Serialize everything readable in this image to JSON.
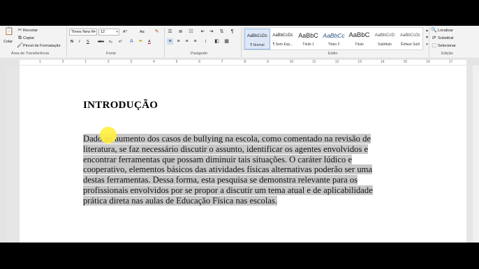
{
  "ribbon": {
    "clipboard": {
      "paste_label": "Colar",
      "cut_label": "Recortar",
      "copy_label": "Copiar",
      "format_painter_label": "Pincel de Formatação",
      "group_label": "Área de Transferência"
    },
    "font": {
      "font_name": "Times New R",
      "font_size": "12",
      "group_label": "Fonte",
      "bold": "N",
      "italic": "I",
      "underline": "S",
      "strike": "abc",
      "subscript": "x₂",
      "superscript": "x²",
      "grow": "A^",
      "case": "Aa",
      "font_color_letter": "A"
    },
    "paragraph": {
      "group_label": "Parágrafo"
    },
    "styles": {
      "group_label": "Estilo",
      "tiles": [
        {
          "preview": "AaBbCcDc",
          "name": "¶ Normal"
        },
        {
          "preview": "AaBbCcDc",
          "name": "¶ Sem Esp..."
        },
        {
          "preview": "AaBbC",
          "name": "Título 1"
        },
        {
          "preview": "AaBbCc",
          "name": "Título 2"
        },
        {
          "preview": "AaBbC",
          "name": "Título"
        },
        {
          "preview": "AaBbCcD",
          "name": "Subtítulo"
        },
        {
          "preview": "AaBbCcDc",
          "name": "Ênfase Sutil"
        }
      ]
    },
    "editing": {
      "find_label": "Localizar",
      "replace_label": "Substituir",
      "select_label": "Selecionar",
      "group_label": "Edição"
    }
  },
  "ruler": {
    "numbers": [
      "1",
      "2",
      "1",
      "2",
      "3",
      "4",
      "5",
      "6",
      "7",
      "8",
      "9",
      "10",
      "11",
      "12",
      "13",
      "14",
      "15",
      "16",
      "17"
    ]
  },
  "document": {
    "heading": "INTRODUÇÃO",
    "paragraph_lines": [
      "Dado ao aumento dos casos de bullying na escola, como comentado na revisão de",
      "literatura, se faz necessário discutir o assunto, identificar os agentes envolvidos e",
      "encontrar ferramentas que possam diminuir tais situações. O caráter lúdico e",
      "cooperativo, elementos básicos das atividades físicas alternativas poderão ser uma",
      "destas ferramentas. Dessa forma, esta pesquisa se demonstra relevante para os",
      "profissionais envolvidos por se propor a discutir um tema atual e de aplicabilidade",
      "prática direta nas aulas de Educação Física nas escolas."
    ]
  },
  "colors": {
    "highlight": "#c8c8c8",
    "cursor_highlight": "#ffee3c",
    "selected_style": "#dce8f7"
  }
}
